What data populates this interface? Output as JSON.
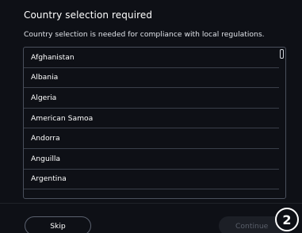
{
  "dialog": {
    "title": "Country selection required",
    "subtitle": "Country selection is needed for compliance with local regulations."
  },
  "countries": [
    "Afghanistan",
    "Albania",
    "Algeria",
    "American Samoa",
    "Andorra",
    "Anguilla",
    "Argentina"
  ],
  "buttons": {
    "skip": "Skip",
    "continue": "Continue"
  },
  "step_badge": "2",
  "colors": {
    "background": "#0e1016",
    "list_border": "#4a505c",
    "continue_disabled_bg": "#1c1f26",
    "continue_disabled_text": "#5a5f6a"
  }
}
